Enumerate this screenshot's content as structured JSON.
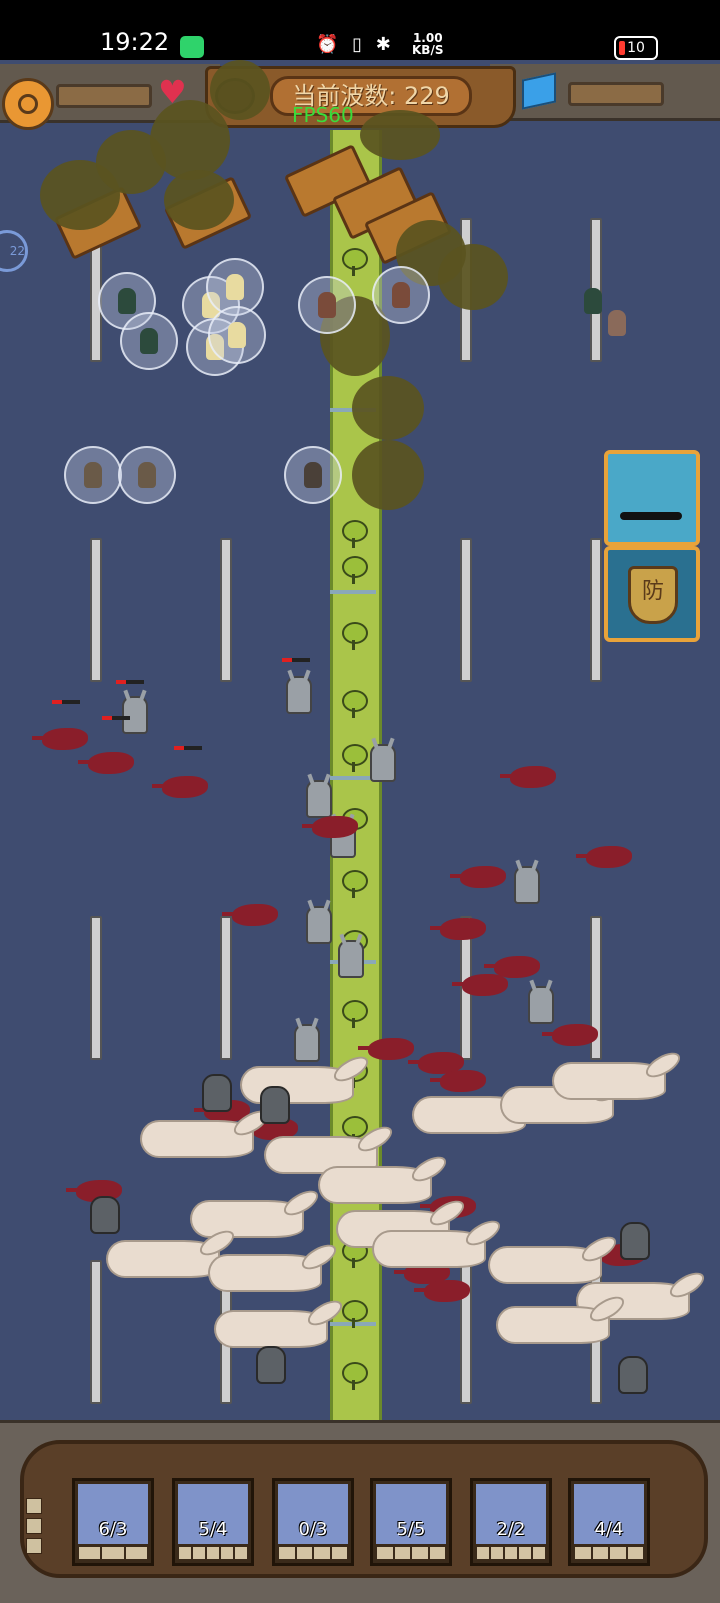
{
  "status_bar": {
    "time": "19:22",
    "icons": "⏰ ▯ ✱",
    "net_speed_value": "1.00",
    "net_speed_unit": "KB/S",
    "battery": "10"
  },
  "hud": {
    "wave_label": "当前波数: 229",
    "fps": "FPS60",
    "colors": {
      "heart": "#e0314f",
      "gear": "#e99733",
      "fps": "#3bdc3b"
    }
  },
  "side_buttons": {
    "defense_glyph": "防"
  },
  "edge_indicator": "22",
  "unit_cards": [
    {
      "count": "6/3",
      "color": "#7f93c9"
    },
    {
      "count": "5/4",
      "color": "#7f93c9"
    },
    {
      "count": "0/3",
      "color": "#7f93c9"
    },
    {
      "count": "5/5",
      "color": "#7f93c9"
    },
    {
      "count": "2/2",
      "color": "#7f93c9"
    },
    {
      "count": "4/4",
      "color": "#7f93c9"
    }
  ]
}
